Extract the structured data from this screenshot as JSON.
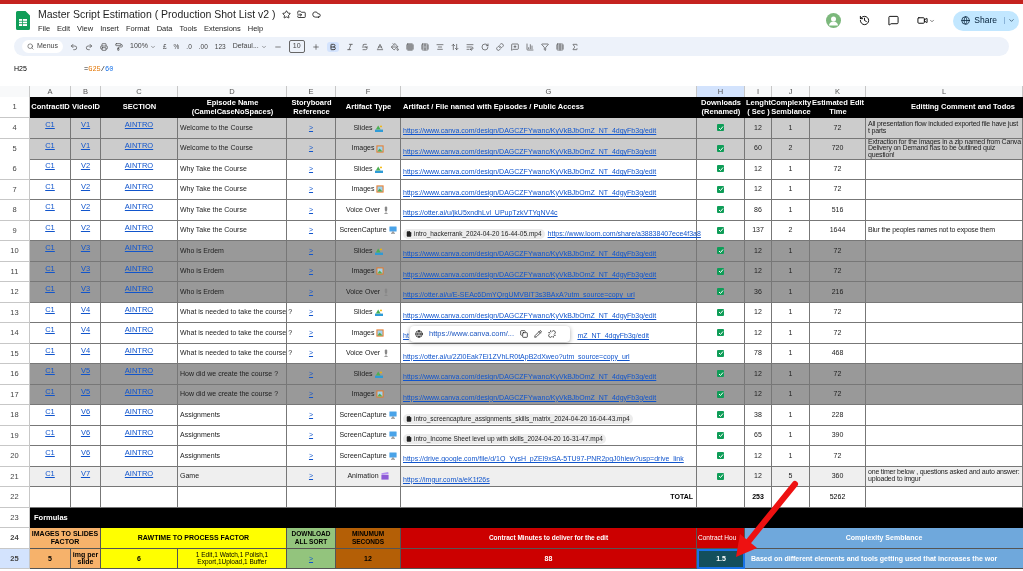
{
  "window": {
    "title": "Master Script Estimation ( Production Shot List v2 )"
  },
  "menu": [
    "File",
    "Edit",
    "View",
    "Insert",
    "Format",
    "Data",
    "Tools",
    "Extensions",
    "Help"
  ],
  "share": "Share",
  "toolbar": {
    "search": "Menus",
    "zoom": "100%",
    "formats": [
      "£",
      "%",
      ".0",
      ".00",
      "123"
    ],
    "font": "Defaul...",
    "font_size": "10",
    "bold": true
  },
  "formula_bar": {
    "cell": "H25",
    "parts": [
      {
        "text": "=",
        "kind": "plain"
      },
      {
        "text": "G25",
        "kind": "ref"
      },
      {
        "text": "/",
        "kind": "plain"
      },
      {
        "text": "60",
        "kind": "number"
      }
    ]
  },
  "columns": [
    {
      "letter": "A",
      "selected": false
    },
    {
      "letter": "B",
      "selected": false
    },
    {
      "letter": "C",
      "selected": false
    },
    {
      "letter": "D",
      "selected": false
    },
    {
      "letter": "E",
      "selected": false
    },
    {
      "letter": "F",
      "selected": false
    },
    {
      "letter": "G",
      "selected": false
    },
    {
      "letter": "H",
      "selected": true
    },
    {
      "letter": "I",
      "selected": false
    },
    {
      "letter": "J",
      "selected": false
    },
    {
      "letter": "K",
      "selected": false
    },
    {
      "letter": "L",
      "selected": false
    }
  ],
  "header": {
    "row": "1",
    "cells": [
      "ContractID",
      "VideoID",
      "SECTION",
      "Episode Name (CamelCaseNoSpaces)",
      "Storyboard Reference",
      "Artifact Type",
      "Artifact  / File named with Episodes / Public Access",
      "Downloads (Renamed)",
      "Lenght ( Sec )",
      "Complexity Semblance",
      "Estimated Edit Time",
      "Editting Comment and Todos"
    ]
  },
  "rows": [
    {
      "row": "4",
      "color": "#cccccc",
      "contract": "C1",
      "video": "V1",
      "section": "AINTRO",
      "episode": "Welcome to the Course",
      "storyboard": ">",
      "artifact_type": {
        "kind": "slides",
        "label": "Slides"
      },
      "artifact": {
        "kind": "link",
        "text": "https://www.canva.com/design/DAGCZFYwanc/KyVkBJbOmZ_NT_4dgyFb3g/edit"
      },
      "downloaded": true,
      "length": "12",
      "complexity": "1",
      "edit_time": "72",
      "comment": "All presentation flow included exported file have just t parts"
    },
    {
      "row": "5",
      "color": "#cccccc",
      "contract": "C1",
      "video": "V1",
      "section": "AINTRO",
      "episode": "Welcome to the Course",
      "storyboard": ">",
      "artifact_type": {
        "kind": "images",
        "label": "Images"
      },
      "artifact": {
        "kind": "link",
        "text": "https://www.canva.com/design/DAGCZFYwanc/KyVkBJbOmZ_NT_4dgyFb3g/edit"
      },
      "downloaded": true,
      "length": "60",
      "complexity": "2",
      "edit_time": "720",
      "comment": "Extraction for the images in a zip named from Canva Delivery on Demand has to be outlined quiz question!"
    },
    {
      "row": "6",
      "color": "#ffffff",
      "contract": "C1",
      "video": "V2",
      "section": "AINTRO",
      "episode": "Why Take the Course",
      "storyboard": ">",
      "artifact_type": {
        "kind": "slides",
        "label": "Slides"
      },
      "artifact": {
        "kind": "link",
        "text": "https://www.canva.com/design/DAGCZFYwanc/KyVkBJbOmZ_NT_4dgyFb3g/edit"
      },
      "downloaded": true,
      "length": "12",
      "complexity": "1",
      "edit_time": "72"
    },
    {
      "row": "7",
      "color": "#ffffff",
      "contract": "C1",
      "video": "V2",
      "section": "AINTRO",
      "episode": "Why Take the Course",
      "storyboard": ">",
      "artifact_type": {
        "kind": "images",
        "label": "Images"
      },
      "artifact": {
        "kind": "link",
        "text": "https://www.canva.com/design/DAGCZFYwanc/KyVkBJbOmZ_NT_4dgyFb3g/edit"
      },
      "downloaded": true,
      "length": "12",
      "complexity": "1",
      "edit_time": "72"
    },
    {
      "row": "8",
      "color": "#ffffff",
      "contract": "C1",
      "video": "V2",
      "section": "AINTRO",
      "episode": "Why Take the Course",
      "storyboard": ">",
      "artifact_type": {
        "kind": "voice",
        "label": "Voice Over"
      },
      "artifact": {
        "kind": "link",
        "text": "https://otter.ai/u/jkU5xndhLvl_UPupTzkVTYqNV4c"
      },
      "downloaded": true,
      "length": "86",
      "complexity": "1",
      "edit_time": "516"
    },
    {
      "row": "9",
      "color": "#ffffff",
      "contract": "C1",
      "video": "V2",
      "section": "AINTRO",
      "episode": "Why Take the Course",
      "storyboard": ">",
      "artifact_type": {
        "kind": "screen",
        "label": "ScreenCapture"
      },
      "artifact": {
        "kind": "file",
        "file": "intro_hackerrank_2024-04-20 16-44-05.mp4",
        "text": "https://www.loom.com/share/a38838407ece4f3a8"
      },
      "downloaded": true,
      "length": "137",
      "complexity": "2",
      "edit_time": "1644",
      "comment": "Blur the peoples names not to expose them"
    },
    {
      "row": "10",
      "color": "#999999",
      "contract": "C1",
      "video": "V3",
      "section": "AINTRO",
      "episode": "Who is Erdem",
      "storyboard": ">",
      "artifact_type": {
        "kind": "slides",
        "label": "Slides"
      },
      "artifact": {
        "kind": "link",
        "text": "https://www.canva.com/design/DAGCZFYwanc/KyVkBJbOmZ_NT_4dgyFb3g/edit"
      },
      "downloaded": true,
      "length": "12",
      "complexity": "1",
      "edit_time": "72"
    },
    {
      "row": "11",
      "color": "#999999",
      "contract": "C1",
      "video": "V3",
      "section": "AINTRO",
      "episode": "Who is Erdem",
      "storyboard": ">",
      "artifact_type": {
        "kind": "images",
        "label": "Images"
      },
      "artifact": {
        "kind": "link",
        "text": "https://www.canva.com/design/DAGCZFYwanc/KyVkBJbOmZ_NT_4dgyFb3g/edit"
      },
      "downloaded": true,
      "length": "12",
      "complexity": "1",
      "edit_time": "72"
    },
    {
      "row": "12",
      "color": "#999999",
      "contract": "C1",
      "video": "V3",
      "section": "AINTRO",
      "episode": "Who is Erdem",
      "storyboard": ">",
      "artifact_type": {
        "kind": "voice",
        "label": "Voice Over"
      },
      "artifact": {
        "kind": "link",
        "text": "https://otter.ai/u/E-SEAc6DmYQrgUMVBIT3s3BAxA?utm_source=copy_url"
      },
      "downloaded": true,
      "length": "36",
      "complexity": "1",
      "edit_time": "216"
    },
    {
      "row": "13",
      "color": "#ffffff",
      "contract": "C1",
      "video": "V4",
      "section": "AINTRO",
      "episode": "What is needed to take the course ?",
      "storyboard": ">",
      "artifact_type": {
        "kind": "slides",
        "label": "Slides"
      },
      "artifact": {
        "kind": "link",
        "text": "https://www.canva.com/design/DAGCZFYwanc/KyVkBJbOmZ_NT_4dgyFb3g/edit"
      },
      "downloaded": true,
      "length": "12",
      "complexity": "1",
      "edit_time": "72"
    },
    {
      "row": "14",
      "color": "#ffffff",
      "contract": "C1",
      "video": "V4",
      "section": "AINTRO",
      "episode": "What is needed to take the course ?",
      "storyboard": ">",
      "artifact_type": {
        "kind": "images",
        "label": "Images"
      },
      "artifact": {
        "kind": "covered",
        "fragments": [
          "ht",
          "mZ_NT_4dgyFb3g/edit"
        ]
      },
      "downloaded": true,
      "length": "12",
      "complexity": "1",
      "edit_time": "72"
    },
    {
      "row": "15",
      "color": "#ffffff",
      "contract": "C1",
      "video": "V4",
      "section": "AINTRO",
      "episode": "What is needed to take the course ?",
      "storyboard": ">",
      "artifact_type": {
        "kind": "voice",
        "label": "Voice Over"
      },
      "artifact": {
        "kind": "link",
        "text": "https://otter.ai/u/2Zl0Eak7Ei1ZVhLR0tApB2dXweo?utm_source=copy_url"
      },
      "downloaded": true,
      "length": "78",
      "complexity": "1",
      "edit_time": "468"
    },
    {
      "row": "16",
      "color": "#999999",
      "contract": "C1",
      "video": "V5",
      "section": "AINTRO",
      "episode": "How did we create the course ?",
      "storyboard": ">",
      "artifact_type": {
        "kind": "slides",
        "label": "Slides"
      },
      "artifact": {
        "kind": "link",
        "text": "https://www.canva.com/design/DAGCZFYwanc/KyVkBJbOmZ_NT_4dgyFb3g/edit"
      },
      "downloaded": true,
      "length": "12",
      "complexity": "1",
      "edit_time": "72"
    },
    {
      "row": "17",
      "color": "#999999",
      "contract": "C1",
      "video": "V5",
      "section": "AINTRO",
      "episode": "How did we create the course ?",
      "storyboard": ">",
      "artifact_type": {
        "kind": "images",
        "label": "Images"
      },
      "artifact": {
        "kind": "link",
        "text": "https://www.canva.com/design/DAGCZFYwanc/KyVkBJbOmZ_NT_4dgyFb3g/edit"
      },
      "downloaded": true,
      "length": "12",
      "complexity": "1",
      "edit_time": "72"
    },
    {
      "row": "18",
      "color": "#ffffff",
      "contract": "C1",
      "video": "V6",
      "section": "AINTRO",
      "episode": "Assignments",
      "storyboard": ">",
      "artifact_type": {
        "kind": "screen",
        "label": "ScreenCapture"
      },
      "artifact": {
        "kind": "file",
        "file": "intro_screencapture_assignments_skills_matrix_2024-04-20 16-04-43.mp4"
      },
      "downloaded": true,
      "length": "38",
      "complexity": "1",
      "edit_time": "228"
    },
    {
      "row": "19",
      "color": "#ffffff",
      "contract": "C1",
      "video": "V6",
      "section": "AINTRO",
      "episode": "Assignments",
      "storyboard": ">",
      "artifact_type": {
        "kind": "screen",
        "label": "ScreenCapture"
      },
      "artifact": {
        "kind": "file",
        "file": "intro_Income Sheet level up with skills_2024-04-20 16-31-47.mp4"
      },
      "downloaded": true,
      "length": "65",
      "complexity": "1",
      "edit_time": "390"
    },
    {
      "row": "20",
      "color": "#ffffff",
      "contract": "C1",
      "video": "V6",
      "section": "AINTRO",
      "episode": "Assignments",
      "storyboard": ">",
      "artifact_type": {
        "kind": "screen",
        "label": "ScreenCapture"
      },
      "artifact": {
        "kind": "link",
        "text": "https://drive.google.com/file/d/1Q_YysH_pZEl9xSA-5TU97-PNR2pgJ0hiew?usp=drive_link"
      },
      "downloaded": true,
      "length": "12",
      "complexity": "1",
      "edit_time": "72"
    },
    {
      "row": "21",
      "color": "#efefef",
      "contract": "C1",
      "video": "V7",
      "section": "AINTRO",
      "episode": "Game",
      "storyboard": ">",
      "artifact_type": {
        "kind": "animation",
        "label": "Animation"
      },
      "artifact": {
        "kind": "link",
        "text": "https://imgur.com/a/eK1f26s"
      },
      "downloaded": true,
      "length": "12",
      "complexity": "5",
      "edit_time": "360",
      "comment": "one timer below , questions  asked and auto answer: uploaded to imgur"
    }
  ],
  "total": {
    "row": "22",
    "label": "TOTAL",
    "length": "253",
    "edit_time": "5262"
  },
  "formulas": {
    "row": "23",
    "title": "Formulas"
  },
  "factors": {
    "header_row": "24",
    "value_row": "25",
    "images_factor": {
      "label": "IMAGES TO SLIDES FACTOR",
      "value": "5",
      "unit": "img per slide"
    },
    "rawtime": {
      "label": "RAWTIME TO PROCESS FACTOR",
      "value": "6",
      "note": "1 Edit,1 Watch,1 Polish,1 Export,1Upload,1 Buffer"
    },
    "download": {
      "label": "DOWNLOAD ALL SORT",
      "value": ">"
    },
    "minimum": {
      "label": "MINUMUM SECONDS",
      "value": "12"
    },
    "contract_minutes": {
      "label": "Contract Minutes to deliver for the edit",
      "value": "88"
    },
    "contract_hours": {
      "label": "Contract Hou",
      "value": "1.5",
      "selected": true
    },
    "complexity": {
      "label": "Complexity Semblance",
      "note": "Based on different elements and tools getting used that increases the wor"
    }
  },
  "link_popup": {
    "url": "https://www.canva.com/..."
  }
}
